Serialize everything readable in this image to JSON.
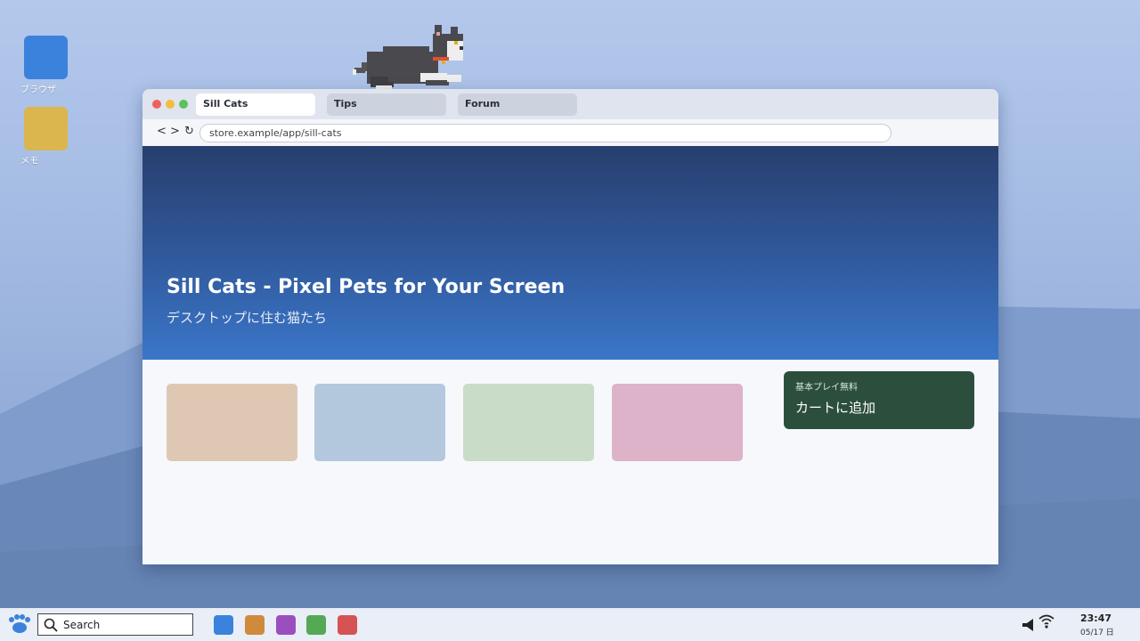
{
  "desktop": {
    "icons": [
      {
        "label": "ブラウザ",
        "color": "#3b82dc"
      },
      {
        "label": "メモ",
        "color": "#dbb54e"
      }
    ]
  },
  "browser": {
    "tabs": [
      {
        "label": "Sill Cats",
        "active": true
      },
      {
        "label": "Tips",
        "active": false
      },
      {
        "label": "Forum",
        "active": false
      }
    ],
    "nav": {
      "back": "<",
      "forward": ">",
      "reload": "↻"
    },
    "url": "store.example/app/sill-cats",
    "hero": {
      "title": "Sill Cats - Pixel Pets for Your Screen",
      "subtitle": "デスクトップに住む猫たち"
    },
    "cards": [
      {
        "color": "#dfc8b3"
      },
      {
        "color": "#b3c8dc"
      },
      {
        "color": "#c9dcc8"
      },
      {
        "color": "#dcb3c8"
      }
    ],
    "cart": {
      "subtitle": "基本プレイ無料",
      "button_label": "カートに追加",
      "color": "#2c4f3d"
    }
  },
  "taskbar": {
    "search_placeholder": "Search",
    "apps": [
      {
        "name": "blue-app",
        "color": "#3b82dc"
      },
      {
        "name": "orange-app",
        "color": "#d08a3c"
      },
      {
        "name": "purple-app",
        "color": "#9b4fbf"
      },
      {
        "name": "green-app",
        "color": "#55a955"
      },
      {
        "name": "red-app",
        "color": "#d65353"
      }
    ],
    "time": "23:47",
    "date": "05/17 日"
  }
}
